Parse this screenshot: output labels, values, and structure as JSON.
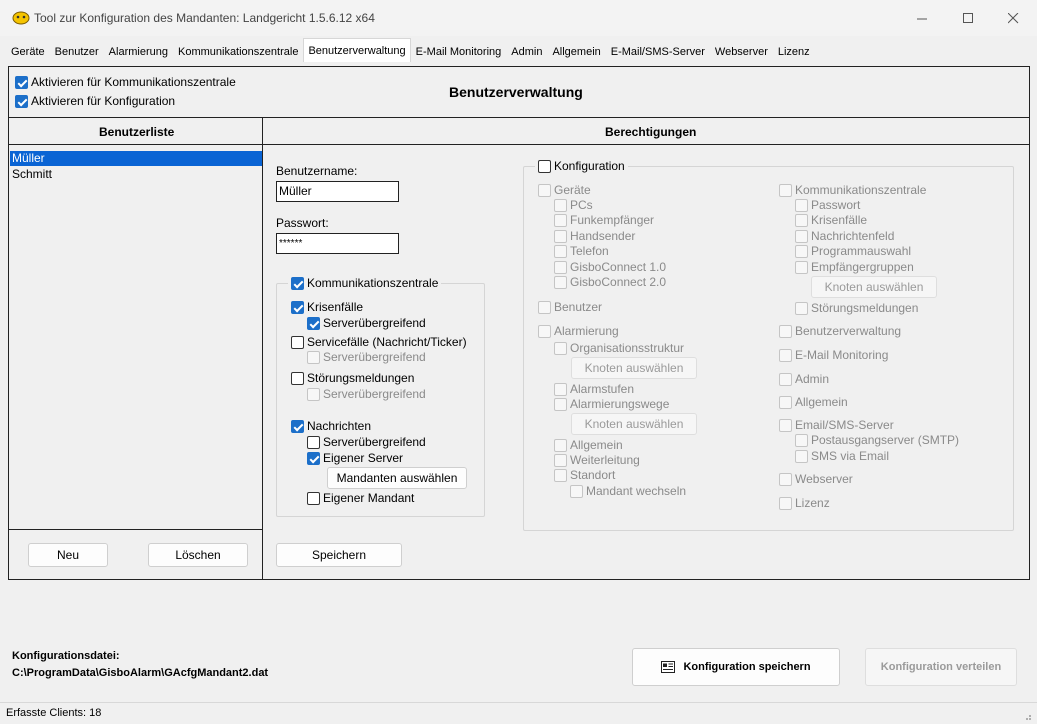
{
  "window": {
    "title": "Tool zur Konfiguration des Mandanten: Landgericht 1.5.6.12 x64"
  },
  "tabs": [
    "Geräte",
    "Benutzer",
    "Alarmierung",
    "Kommunikationszentrale",
    "Benutzerverwaltung",
    "E-Mail Monitoring",
    "Admin",
    "Allgemein",
    "E-Mail/SMS-Server",
    "Webserver",
    "Lizenz"
  ],
  "active_tab": "Benutzerverwaltung",
  "header": {
    "activate_komm": "Aktivieren für Kommunikationszentrale",
    "activate_konf": "Aktivieren für Konfiguration",
    "title": "Benutzerverwaltung"
  },
  "userlist": {
    "title": "Benutzerliste",
    "items": [
      "Müller",
      "Schmitt"
    ],
    "new_button": "Neu",
    "delete_button": "Löschen"
  },
  "perm": {
    "title": "Berechtigungen",
    "username_label": "Benutzername:",
    "username_value": "Müller",
    "password_label": "Passwort:",
    "password_value": "******",
    "save_button": "Speichern",
    "komm": {
      "title": "Kommunikationszentrale",
      "krisen": "Krisenfälle",
      "krisen_server": "Serverübergreifend",
      "service": "Servicefälle (Nachricht/Ticker)",
      "service_server": "Serverübergreifend",
      "stoerung": "Störungsmeldungen",
      "stoerung_server": "Serverübergreifend",
      "nachrichten": "Nachrichten",
      "nachr_server": "Serverübergreifend",
      "eigener_server": "Eigener Server",
      "mandanten_button": "Mandanten auswählen",
      "eigener_mandant": "Eigener Mandant"
    },
    "konf": {
      "title": "Konfiguration",
      "geraete": "Geräte",
      "pcs": "PCs",
      "funk": "Funkempfänger",
      "hand": "Handsender",
      "telefon": "Telefon",
      "gc1": "GisboConnect 1.0",
      "gc2": "GisboConnect 2.0",
      "benutzer": "Benutzer",
      "alarmierung": "Alarmierung",
      "orga": "Organisationsstruktur",
      "knoten1": "Knoten auswählen",
      "alarmstufen": "Alarmstufen",
      "alarmwege": "Alarmierungswege",
      "knoten2": "Knoten auswählen",
      "allgemein_a": "Allgemein",
      "weiterleitung": "Weiterleitung",
      "standort": "Standort",
      "mandant_wechseln": "Mandant wechseln",
      "komm": "Kommunikationszentrale",
      "k_passwort": "Passwort",
      "k_krisen": "Krisenfälle",
      "k_nachrichtenfeld": "Nachrichtenfeld",
      "k_programm": "Programmauswahl",
      "k_empf": "Empfängergruppen",
      "knoten3": "Knoten auswählen",
      "k_stoerung": "Störungsmeldungen",
      "benutzerverwaltung": "Benutzerverwaltung",
      "email_mon": "E-Mail Monitoring",
      "admin": "Admin",
      "allgemein": "Allgemein",
      "email_sms": "Email/SMS-Server",
      "smtp": "Postausgangserver (SMTP)",
      "sms_email": "SMS via Email",
      "webserver": "Webserver",
      "lizenz": "Lizenz"
    }
  },
  "footer": {
    "config_label": "Konfigurationsdatei:",
    "config_path": "C:\\ProgramData\\GisboAlarm\\GAcfgMandant2.dat",
    "save_config": "Konfiguration speichern",
    "distribute_config": "Konfiguration verteilen"
  },
  "status": {
    "clients": "Erfasste Clients: 18"
  }
}
